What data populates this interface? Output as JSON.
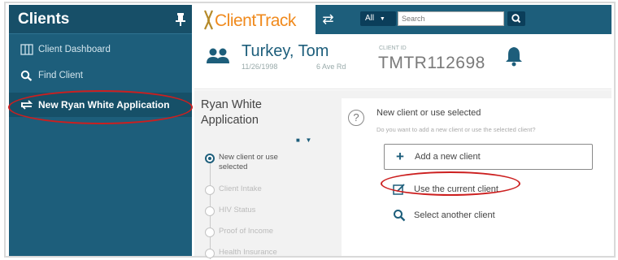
{
  "sidebar": {
    "title": "Clients",
    "items": [
      {
        "label": "Client Dashboard",
        "icon": "dashboard-icon"
      },
      {
        "label": "Find Client",
        "icon": "search-icon"
      },
      {
        "label": "New Ryan White Application",
        "icon": "swap-icon",
        "active": true
      }
    ]
  },
  "header": {
    "logo": "ClientTrack",
    "search_scope": "All",
    "search_placeholder": "Search"
  },
  "client": {
    "name": "Turkey, Tom",
    "dob": "11/26/1998",
    "address": "6 Ave Rd",
    "id_label": "CLIENT ID",
    "id": "TMTR112698"
  },
  "wizard": {
    "title": "Ryan White Application",
    "steps": [
      {
        "label": "New client or use selected",
        "current": true
      },
      {
        "label": "Client Intake"
      },
      {
        "label": "HIV Status"
      },
      {
        "label": "Proof of Income"
      },
      {
        "label": "Health Insurance"
      }
    ]
  },
  "content": {
    "question": "New client or use selected",
    "subtitle": "Do you want to add a new client or use the selected client?",
    "options": {
      "add": "Add a new client",
      "current": "Use the current client",
      "select": "Select another client"
    }
  },
  "colors": {
    "sidebar": "#1d5e7b",
    "accent_orange": "#f08a1d",
    "highlight_red": "#cc1f1f"
  }
}
